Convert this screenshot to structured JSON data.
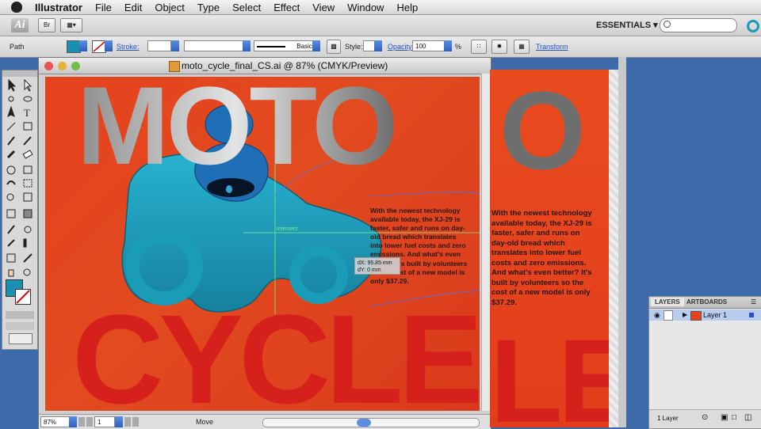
{
  "menubar": {
    "app_name": "Illustrator",
    "items": [
      "File",
      "Edit",
      "Object",
      "Type",
      "Select",
      "Effect",
      "View",
      "Window",
      "Help"
    ]
  },
  "appbar": {
    "ai_badge": "Ai",
    "br_badge": "Br",
    "workspace": "ESSENTIALS ▾"
  },
  "control_bar": {
    "selection_type": "Path",
    "stroke_label": "Stroke:",
    "brush_label": "Basic",
    "style_label": "Style:",
    "opacity_label": "Opacity:",
    "opacity_value": "100",
    "opacity_unit": "%",
    "transform_label": "Transform"
  },
  "document": {
    "title": "moto_cycle_final_CS.ai @ 87% (CMYK/Preview)",
    "zoom": "87%",
    "artboard_number": "1",
    "status_tool": "Move",
    "headline_top": "MOTO",
    "headline_bottom": "CYCLE",
    "body_text": "With the newest technology available today, the XJ-29 is faster, safer and runs on day-old bread which translates into lower fuel costs and zero emissions. And what's even better? It's built by volunteers so the cost of a new model is only $37.29.",
    "smart_guide_label": "intersect",
    "tooltip_dx": "dX: 95.85 mm",
    "tooltip_dy": "dY: 0 mm"
  },
  "second_artboard": {
    "headline_top": "O",
    "headline_bottom": "LE",
    "body_lines": [
      "With the newest technology",
      "available today, the XJ-29 is",
      "faster, safer and runs on",
      "day-old bread which",
      "translates into lower fuel",
      "costs and zero emissions.",
      "And what's even better? It's",
      "built by volunteers so the",
      "cost of a new model is only",
      "$37.29."
    ]
  },
  "layers_panel": {
    "tabs": [
      "LAYERS",
      "ARTBOARDS"
    ],
    "layer_name": "Layer 1",
    "footer_count": "1 Layer"
  },
  "colors": {
    "artboard_orange": "#e5421e",
    "headline_red": "#d6201b",
    "rider_teal": "#1fa3c0",
    "helmet_blue": "#1e6fb5",
    "desktop_blue": "#3d6aa8",
    "fill_swatch": "#1b8fb0"
  },
  "icons": [
    "apple-icon",
    "search-icon",
    "creative-cloud-icon",
    "selection-tool-icon",
    "direct-selection-tool-icon",
    "pen-tool-icon",
    "type-tool-icon",
    "line-tool-icon",
    "rectangle-tool-icon",
    "paintbrush-tool-icon",
    "pencil-tool-icon",
    "rotate-tool-icon",
    "scale-tool-icon",
    "zoom-tool-icon",
    "hand-tool-icon",
    "eye-icon",
    "disclosure-triangle-icon"
  ]
}
